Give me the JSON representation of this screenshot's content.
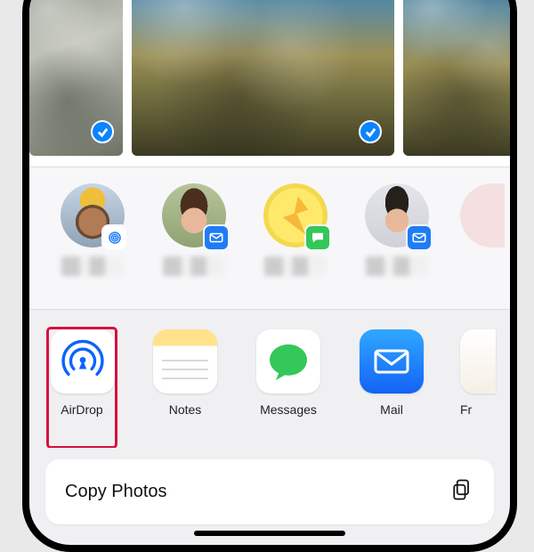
{
  "photos": {
    "count_visible": 3,
    "selected_indices": [
      0,
      1,
      2
    ]
  },
  "contacts": {
    "items": [
      {
        "name": "",
        "badge": "airdrop"
      },
      {
        "name": "",
        "badge": "mail"
      },
      {
        "name": "",
        "badge": "messages"
      },
      {
        "name": "",
        "badge": "mail"
      },
      {
        "name": "",
        "badge": ""
      }
    ]
  },
  "apps": {
    "items": [
      {
        "label": "AirDrop",
        "icon": "airdrop"
      },
      {
        "label": "Notes",
        "icon": "notes"
      },
      {
        "label": "Messages",
        "icon": "messages"
      },
      {
        "label": "Mail",
        "icon": "mail"
      },
      {
        "label": "Fr",
        "icon": "freeform"
      }
    ],
    "highlight_index": 0
  },
  "actions": {
    "copy_label": "Copy Photos"
  },
  "colors": {
    "ios_blue": "#0a84ff",
    "ios_green": "#34c759",
    "mail_blue": "#1f7cf6",
    "highlight_red": "#d6123a"
  }
}
